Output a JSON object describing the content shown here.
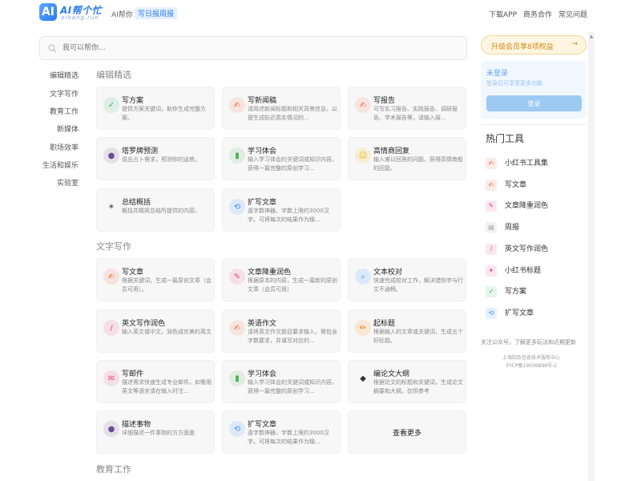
{
  "header": {
    "logo_badge": "AI",
    "logo_title": "AI帮个忙",
    "logo_sub": "aibang.run",
    "nav_home": "AI帮你",
    "nav_active": "写日报周报",
    "download_app": "下载APP",
    "business": "商务合作",
    "faq": "常见问题"
  },
  "search": {
    "placeholder": "我可以帮你..."
  },
  "leftnav": [
    "编辑精选",
    "文字写作",
    "教育工作",
    "新媒体",
    "职场效率",
    "生活和娱乐",
    "实验室"
  ],
  "sections": {
    "editor": "编辑精选",
    "writing": "文字写作",
    "education": "教育工作"
  },
  "editor_cards": [
    {
      "title": "写方案",
      "desc": "提供方案关键词，助你生成完整方案。",
      "icon": "document-check-icon",
      "color": "#3cb371",
      "glyph": "✓"
    },
    {
      "title": "写新闻稿",
      "desc": "请简述新闻标题和相关背景信息，以便生成贴近真实情况的...",
      "icon": "pen-icon",
      "color": "#f06a3a",
      "glyph": "✍"
    },
    {
      "title": "写报告",
      "desc": "可写实习报告、实践报告、调研报告、学术报告等，请输入报...",
      "icon": "pen-icon",
      "color": "#f06a3a",
      "glyph": "✍"
    },
    {
      "title": "塔罗牌预测",
      "desc": "说出占卜需求，预测你的运势。",
      "icon": "crystal-ball-icon",
      "color": "#6a4c93",
      "glyph": "●"
    },
    {
      "title": "学习体会",
      "desc": "输入学习体会的关键词或知识内容，获得一篇完整的原创学习...",
      "icon": "books-icon",
      "color": "#4caf50",
      "glyph": "▮"
    },
    {
      "title": "高情商回复",
      "desc": "输入难以回答的问题，获得高情商般的回复。",
      "icon": "smile-icon",
      "color": "#f5b400",
      "glyph": "☺"
    },
    {
      "title": "总结概括",
      "desc": "概括并精简总结所提供的内容。",
      "icon": "telescope-icon",
      "color": "#555",
      "glyph": "✶"
    },
    {
      "title": "扩写文章",
      "desc": "逢字数神器，字数上限约3000汉字。可将每次的结果作为输...",
      "icon": "expand-icon",
      "color": "#3d8bfd",
      "glyph": "⟲"
    }
  ],
  "writing_cards": [
    {
      "title": "写文章",
      "desc": "根据关键词，生成一篇原创文章（会员可用）。",
      "icon": "pen-icon",
      "color": "#f06a3a",
      "glyph": "✍"
    },
    {
      "title": "文章降重润色",
      "desc": "根据原本的内容，生成一篇新的原创文章（会员可用）",
      "icon": "document-edit-icon",
      "color": "#e84a8a",
      "glyph": "✎"
    },
    {
      "title": "文本校对",
      "desc": "快速完成校对工作，解决错别字与行文不通畅。",
      "icon": "magnifier-icon",
      "color": "#3d8bfd",
      "glyph": "⌕"
    },
    {
      "title": "英文写作润色",
      "desc": "输入英文或中文，润色成优美的英文",
      "icon": "feather-pen-icon",
      "color": "#e84a8a",
      "glyph": "/"
    },
    {
      "title": "英语作文",
      "desc": "请将英文作文题目要求输入，需包含字数要求，并填写对应的...",
      "icon": "pen-icon",
      "color": "#f06a3a",
      "glyph": "✍"
    },
    {
      "title": "起标题",
      "desc": "根据输入的文章或关键词，生成五个好标题。",
      "icon": "pencil-icon",
      "color": "#f57c00",
      "glyph": "✏"
    },
    {
      "title": "写邮件",
      "desc": "描述需求快速生成专业邮件。如需用英文等语言请在输入时注...",
      "icon": "mail-icon",
      "color": "#e84a8a",
      "glyph": "✉"
    },
    {
      "title": "学习体会",
      "desc": "输入学习体会的关键词或知识内容，获得一篇完整的原创学习...",
      "icon": "books-icon",
      "color": "#4caf50",
      "glyph": "▮"
    },
    {
      "title": "编论文大纲",
      "desc": "根据论文的标题和关键词，生成论文摘要和大纲，仅供参考",
      "icon": "graduation-cap-icon",
      "color": "#333",
      "glyph": "◆"
    },
    {
      "title": "描述事物",
      "desc": "详细描述一件事物的方方面面",
      "icon": "detective-icon",
      "color": "#6a4c93",
      "glyph": "●"
    },
    {
      "title": "扩写文章",
      "desc": "逢字数神器，字数上限约3000汉字。可将每次的结果作为输...",
      "icon": "expand-icon",
      "color": "#3d8bfd",
      "glyph": "⟲"
    }
  ],
  "more_label": "查看更多",
  "sidebar": {
    "upgrade": "升级会员享8项权益",
    "login_title": "未登录",
    "login_desc": "登录后可享受更多功能",
    "login_btn": "登录",
    "hot_title": "热门工具",
    "hot_items": [
      {
        "label": "小红书工具集",
        "icon": "pen-icon",
        "color": "#f06a3a",
        "glyph": "✍"
      },
      {
        "label": "写文章",
        "icon": "pen-icon",
        "color": "#f06a3a",
        "glyph": "✍"
      },
      {
        "label": "文章降重润色",
        "icon": "document-edit-icon",
        "color": "#e84a8a",
        "glyph": "✎"
      },
      {
        "label": "周报",
        "icon": "clipboard-icon",
        "color": "#a0a0a0",
        "glyph": "▤"
      },
      {
        "label": "英文写作润色",
        "icon": "feather-pen-icon",
        "color": "#e84a8a",
        "glyph": "/"
      },
      {
        "label": "小红书标题",
        "icon": "pin-icon",
        "color": "#e84a8a",
        "glyph": "✦"
      },
      {
        "label": "写方案",
        "icon": "document-check-icon",
        "color": "#3cb371",
        "glyph": "✓"
      },
      {
        "label": "扩写文章",
        "icon": "expand-icon",
        "color": "#3d8bfd",
        "glyph": "⟲"
      }
    ],
    "follow": "关注公众号，了解更多玩法和近期更新",
    "company": "上海阳及信息技术服务中心",
    "icp": "沪ICP备19036898号-2"
  }
}
